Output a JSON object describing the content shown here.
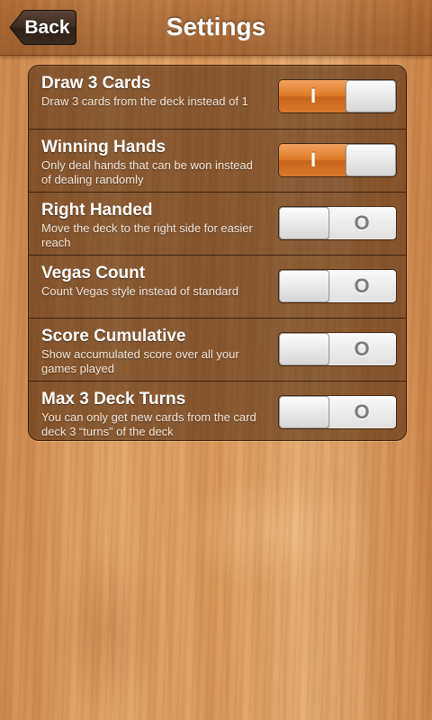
{
  "header": {
    "back_label": "Back",
    "title": "Settings"
  },
  "settings": [
    {
      "title": "Draw 3 Cards",
      "description": "Draw 3 cards from the deck instead of 1",
      "enabled": true,
      "on_label": "I",
      "off_label": "O"
    },
    {
      "title": "Winning Hands",
      "description": "Only deal hands that can be won instead of dealing randomly",
      "enabled": true,
      "on_label": "I",
      "off_label": "O"
    },
    {
      "title": "Right Handed",
      "description": "Move the deck to the right side for easier reach",
      "enabled": false,
      "on_label": "I",
      "off_label": "O"
    },
    {
      "title": "Vegas Count",
      "description": "Count Vegas style instead of standard",
      "enabled": false,
      "on_label": "I",
      "off_label": "O"
    },
    {
      "title": "Score Cumulative",
      "description": "Show accumulated score over all your games played",
      "enabled": false,
      "on_label": "I",
      "off_label": "O"
    },
    {
      "title": "Max 3 Deck Turns",
      "description": "You can only get new cards from the card deck 3 “turns” of the deck",
      "enabled": false,
      "on_label": "I",
      "off_label": "O"
    }
  ],
  "colors": {
    "toggle_on": "#de7b2a",
    "toggle_off": "#ececec",
    "back_button": "#3a2a1e"
  }
}
